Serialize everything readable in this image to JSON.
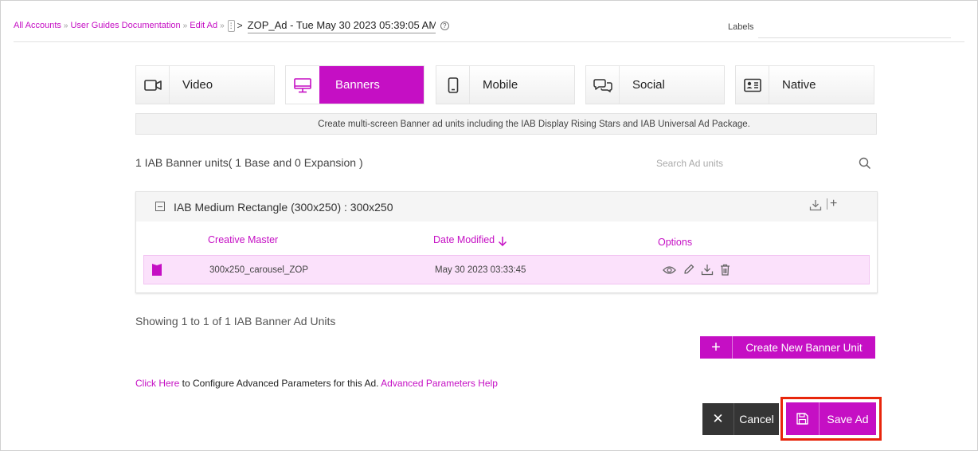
{
  "breadcrumb": {
    "items": [
      "All Accounts",
      "User Guides Documentation",
      "Edit Ad"
    ],
    "separator": "»",
    "kebab": "⋮",
    "arrow": ">",
    "ad_name": "ZOP_Ad - Tue May 30 2023 05:39:05 AM",
    "help": "?"
  },
  "labels": {
    "title": "Labels",
    "value": ""
  },
  "tabs": [
    {
      "label": "Video",
      "icon": "video-icon",
      "active": false
    },
    {
      "label": "Banners",
      "icon": "monitor-icon",
      "active": true
    },
    {
      "label": "Mobile",
      "icon": "mobile-icon",
      "active": false
    },
    {
      "label": "Social",
      "icon": "chat-bubbles-icon",
      "active": false
    },
    {
      "label": "Native",
      "icon": "id-card-icon",
      "active": false
    }
  ],
  "description": "Create multi-screen Banner ad units including the IAB Display Rising Stars and IAB Universal Ad Package.",
  "summary": "1 IAB Banner units( 1 Base and 0 Expansion )",
  "search": {
    "placeholder": "Search Ad units"
  },
  "unit": {
    "title": "IAB Medium Rectangle (300x250) : 300x250",
    "plus": "+",
    "columns": {
      "creative": "Creative Master",
      "date": "Date Modified",
      "options": "Options"
    },
    "rows": [
      {
        "creative": "300x250_carousel_ZOP",
        "date": "May 30 2023 03:33:45"
      }
    ]
  },
  "showing": "Showing 1 to 1 of 1 IAB Banner Ad Units",
  "create_button": {
    "icon": "+",
    "label": "Create New Banner Unit"
  },
  "advanced": {
    "link": "Click Here",
    "text": " to Configure Advanced Parameters for this Ad. ",
    "help_link": "Advanced Parameters Help"
  },
  "actions": {
    "cancel_icon": "✕",
    "cancel": "Cancel",
    "save": "Save Ad"
  },
  "colors": {
    "accent": "#c50fc4",
    "highlight": "#e8260c",
    "dark": "#353535"
  }
}
